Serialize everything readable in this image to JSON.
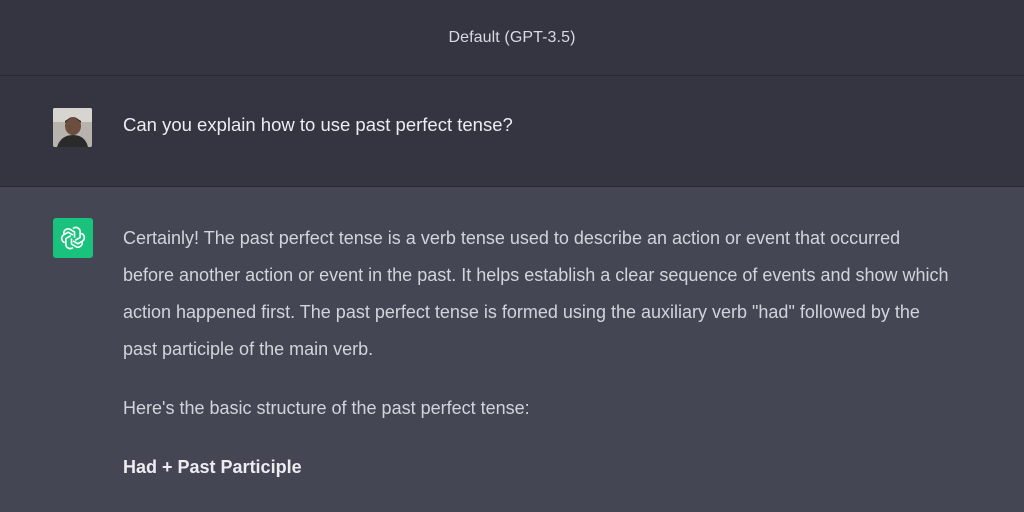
{
  "header": {
    "model_label": "Default (GPT-3.5)"
  },
  "user_message": {
    "text": "Can you explain how to use past perfect tense?"
  },
  "assistant_message": {
    "paragraphs": [
      "Certainly! The past perfect tense is a verb tense used to describe an action or event that occurred before another action or event in the past. It helps establish a clear sequence of events and show which action happened first. The past perfect tense is formed using the auxiliary verb \"had\" followed by the past participle of the main verb.",
      "Here's the basic structure of the past perfect tense:",
      "Had + Past Participle"
    ]
  },
  "colors": {
    "user_bg": "#343541",
    "assistant_bg": "#444654",
    "gpt_avatar_bg": "#19c37d",
    "underline": "#e0141f"
  },
  "icons": {
    "user_avatar": "user-photo-avatar",
    "assistant_avatar": "openai-logo-icon"
  }
}
